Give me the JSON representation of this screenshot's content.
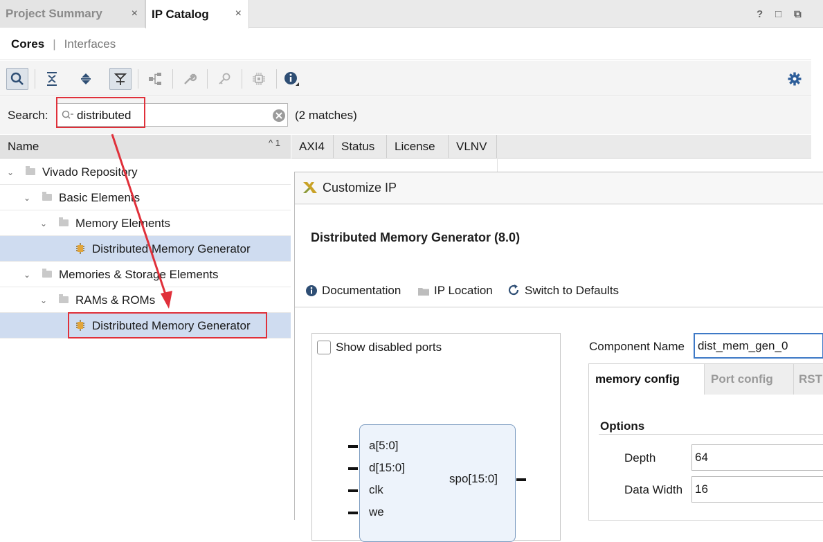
{
  "tabs": [
    {
      "label": "Project Summary",
      "close": "×"
    },
    {
      "label": "IP Catalog",
      "close": "×"
    }
  ],
  "window_controls": {
    "help": "?",
    "restore": "□",
    "float": "⧉"
  },
  "subtabs": {
    "cores": "Cores",
    "separator": "|",
    "interfaces": "Interfaces"
  },
  "toolbar": {
    "icons": [
      "search-icon",
      "collapse-all-icon",
      "expand-all-icon",
      "group-icon",
      "hierarchy-icon",
      "wrench-icon",
      "key-icon",
      "chip-icon",
      "info-icon"
    ],
    "settings_icon": "gear-icon"
  },
  "search": {
    "label": "Search:",
    "value": "distributed",
    "matches": "(2 matches)"
  },
  "columns": {
    "name": "Name",
    "sort_indicator": "^ 1",
    "axi4": "AXI4",
    "status": "Status",
    "license": "License",
    "vlnv": "VLNV"
  },
  "tree": [
    {
      "label": "Vivado Repository"
    },
    {
      "label": "Basic Elements"
    },
    {
      "label": "Memory Elements"
    },
    {
      "label": "Distributed Memory Generator"
    },
    {
      "label": "Memories & Storage Elements"
    },
    {
      "label": "RAMs & ROMs"
    },
    {
      "label": "Distributed Memory Generator"
    }
  ],
  "dialog": {
    "title": "Customize IP",
    "ip_name": "Distributed Memory Generator (8.0)",
    "links": {
      "documentation": "Documentation",
      "ip_location": "IP Location",
      "switch_defaults": "Switch to Defaults"
    },
    "show_disabled_ports": "Show disabled ports",
    "ports_left": [
      "a[5:0]",
      "d[15:0]",
      "clk",
      "we"
    ],
    "port_right": "spo[15:0]",
    "component_name_label": "Component Name",
    "component_name_value": "dist_mem_gen_0",
    "config_tabs": [
      "memory config",
      "Port config",
      "RST"
    ],
    "options_title": "Options",
    "depth_label": "Depth",
    "depth_value": "64",
    "data_width_label": "Data Width",
    "data_width_value": "16"
  },
  "colors": {
    "accent_red": "#e0303a",
    "selection": "#cfdcf0",
    "icon_blue": "#2e4e74"
  }
}
